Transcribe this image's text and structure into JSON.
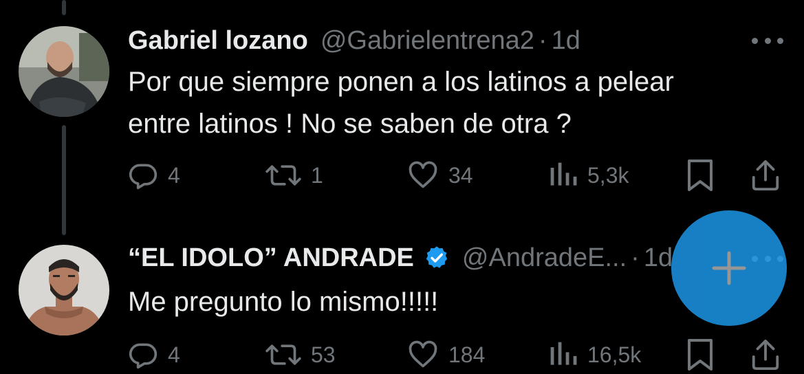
{
  "tweets": [
    {
      "display_name": "Gabriel lozano",
      "handle": "@Gabrielentrena2",
      "separator": "·",
      "time": "1d",
      "text_lines": [
        "Por que siempre ponen a los latinos a pelear",
        "entre latinos ! No se saben  de otra ?"
      ],
      "verified": false,
      "stats": {
        "replies": "4",
        "retweets": "1",
        "likes": "34",
        "views": "5,3k"
      }
    },
    {
      "display_name": "“EL IDOLO” ANDRADE",
      "handle": "@AndradeE...",
      "separator": "·",
      "time": "1d",
      "text_lines": [
        "Me pregunto lo mismo!!!!!"
      ],
      "verified": true,
      "stats": {
        "replies": "4",
        "retweets": "53",
        "likes": "184",
        "views": "16,5k"
      }
    }
  ],
  "icons": [
    "reply-icon",
    "retweet-icon",
    "like-icon",
    "views-icon",
    "bookmark-icon",
    "share-icon",
    "more-icon",
    "verified-icon",
    "compose-plus-icon"
  ],
  "colors": {
    "background": "#000000",
    "text": "#e7e9ea",
    "muted": "#71767b",
    "accent": "#1d9bf0",
    "thread_line": "#333639"
  }
}
